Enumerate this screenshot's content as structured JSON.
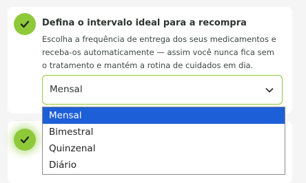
{
  "step": {
    "title": "Defina o intervalo ideal para a recompra",
    "description": "Escolha a frequência de entrega dos seus medicamentos e receba-os automaticamente — assim você nunca fica sem o tratamento e mantém a rotina de cuidados em dia.",
    "check_icon": "check-icon",
    "accent_color": "#8fc93a"
  },
  "frequency_select": {
    "value": "Mensal",
    "icon": "chevron-down-icon",
    "options": [
      "Mensal",
      "Bimestral",
      "Quinzenal",
      "Diário"
    ],
    "highlight_color": "#1d5fd6"
  },
  "next_step": {
    "check_icon": "check-icon"
  }
}
